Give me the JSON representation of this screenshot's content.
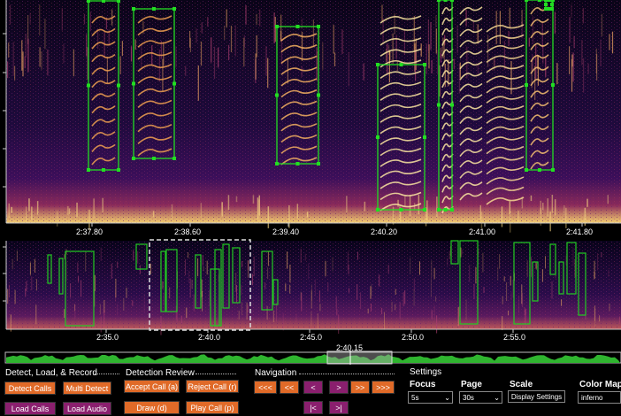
{
  "main_spectrogram": {
    "tick_labels": [
      "2:37.80",
      "2:38.60",
      "2:39.40",
      "2:40.20",
      "2:41.00",
      "2:41.80"
    ]
  },
  "overview_spectrogram": {
    "tick_labels": [
      "2:35.0",
      "2:40.0",
      "2:45.0",
      "2:50.0",
      "2:55.0"
    ]
  },
  "timeline": {
    "position_label": "2:40.15"
  },
  "detect_section": {
    "title": "Detect, Load, & Record",
    "buttons": [
      "Detect Calls",
      "Multi Detect",
      "Load Calls",
      "Load Audio"
    ]
  },
  "review_section": {
    "title": "Detection Review",
    "buttons": [
      "Accept Call (a)",
      "Reject Call (r)",
      "Draw (d)",
      "Play Call (p)"
    ]
  },
  "navigation_section": {
    "title": "Navigation",
    "buttons": [
      "<<<",
      "<<",
      "<",
      ">",
      ">>",
      ">>>",
      "|<",
      ">|"
    ]
  },
  "settings_section": {
    "title": "Settings",
    "focus": {
      "label": "Focus",
      "value": "5s"
    },
    "page": {
      "label": "Page",
      "value": "30s"
    },
    "scale": {
      "label": "Scale",
      "button": "Display Settings"
    },
    "colormap": {
      "label": "Color Map",
      "value": "inferno"
    }
  },
  "colors": {
    "detection_box": "#22dd22",
    "orange_button": "#e06a28",
    "purple_button": "#8a1f6e"
  }
}
